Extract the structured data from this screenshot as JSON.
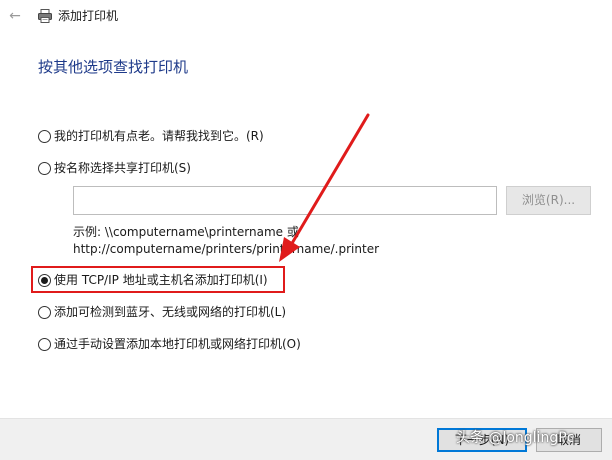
{
  "window": {
    "title": "添加打印机"
  },
  "page": {
    "heading": "按其他选项查找打印机"
  },
  "options": [
    {
      "label": "我的打印机有点老。请帮我找到它。(R)",
      "checked": false
    },
    {
      "label": "按名称选择共享打印机(S)",
      "checked": false
    },
    {
      "label": "使用 TCP/IP 地址或主机名添加打印机(I)",
      "checked": true
    },
    {
      "label": "添加可检测到蓝牙、无线或网络的打印机(L)",
      "checked": false
    },
    {
      "label": "通过手动设置添加本地打印机或网络打印机(O)",
      "checked": false
    }
  ],
  "share": {
    "value": "",
    "browse_label": "浏览(R)...",
    "example_line1": "示例: \\\\computername\\printername 或",
    "example_line2": "http://computername/printers/printername/.printer"
  },
  "footer": {
    "next_label": "下一步(N)",
    "cancel_label": "取消"
  },
  "watermark": {
    "text": "头条 @longlingPc"
  },
  "colors": {
    "heading": "#1e3a8a",
    "annotation": "#e01b1b",
    "accent": "#0078d7"
  },
  "icons": {
    "back": "arrow-left-icon",
    "app": "printer-icon"
  }
}
